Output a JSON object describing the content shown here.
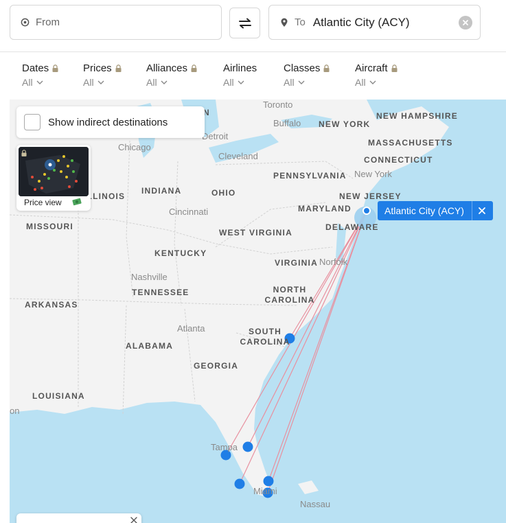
{
  "search": {
    "from_placeholder": "From",
    "to_label": "To",
    "to_value": "Atlantic City (ACY)"
  },
  "filters": [
    {
      "title": "Dates",
      "value": "All",
      "locked": true
    },
    {
      "title": "Prices",
      "value": "All",
      "locked": true
    },
    {
      "title": "Alliances",
      "value": "All",
      "locked": true
    },
    {
      "title": "Airlines",
      "value": "All",
      "locked": false
    },
    {
      "title": "Classes",
      "value": "All",
      "locked": true
    },
    {
      "title": "Aircraft",
      "value": "All",
      "locked": true
    }
  ],
  "map": {
    "indirect_label": "Show indirect destinations",
    "price_view_label": "Price view",
    "destination_pill": "Atlantic City (ACY)",
    "region_labels": [
      "NEW YORK",
      "NEW HAMPSHIRE",
      "MASSACHUSETTS",
      "CONNECTICUT",
      "PENNSYLVANIA",
      "NEW JERSEY",
      "MARYLAND",
      "DELAWARE",
      "INDIANA",
      "OHIO",
      "ILLINOIS",
      "MISSOURI",
      "WEST VIRGINIA",
      "KENTUCKY",
      "VIRGINIA",
      "NORTH CAROLINA",
      "TENNESSEE",
      "ARKANSAS",
      "SOUTH CAROLINA",
      "ALABAMA",
      "GEORGIA",
      "LOUISIANA",
      "N"
    ],
    "city_labels": [
      "Toronto",
      "Buffalo",
      "Detroit",
      "Chicago",
      "Cleveland",
      "New York",
      "Cincinnati",
      "Norfolk",
      "Nashville",
      "Atlanta",
      "Tampa",
      "Miami",
      "Nassau",
      "on"
    ],
    "colors": {
      "water": "#b9e1f3",
      "land": "#f3f3f3",
      "route": "#e8909f",
      "airport": "#1f7ee6"
    }
  }
}
